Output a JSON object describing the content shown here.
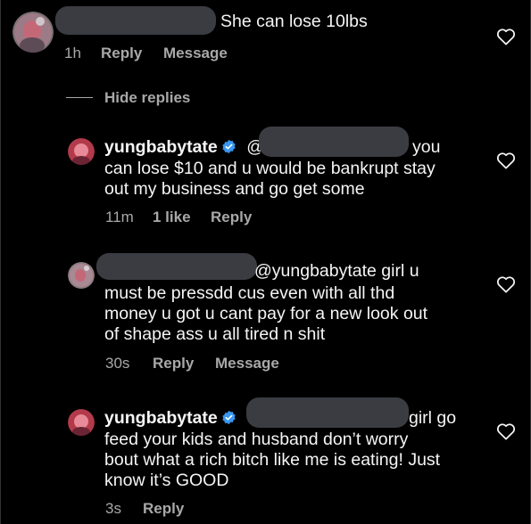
{
  "top_comment": {
    "text": "She can lose 10lbs",
    "time": "1h",
    "reply_label": "Reply",
    "message_label": "Message"
  },
  "thread": {
    "hide_replies_label": "Hide replies"
  },
  "replies": [
    {
      "username": "yungbabytate",
      "mention_start": "@",
      "line1_end": "you",
      "lines": [
        "can lose $10 and u would be bankrupt stay",
        "out my business and go get some"
      ],
      "time": "11m",
      "likes": "1 like",
      "reply_label": "Reply"
    },
    {
      "line1_end": "@yungbabytate girl u",
      "lines": [
        "must be pressdd cus even with all thd",
        "money u got u cant pay for a new look out",
        "of shape ass u all tired n shit"
      ],
      "time": "30s",
      "reply_label": "Reply",
      "message_label": "Message"
    },
    {
      "username": "yungbabytate",
      "line1_end": "girl go",
      "lines": [
        "feed your kids and husband don’t worry",
        "bout what a rich bitch like me is eating! Just",
        "know it’s GOOD"
      ],
      "time": "3s",
      "reply_label": "Reply"
    }
  ],
  "icons": {
    "like": "heart-outline-icon",
    "verified": "verified-badge-icon"
  },
  "colors": {
    "background": "#000000",
    "text": "#f5f5f5",
    "secondary": "#a8a8a8",
    "verified": "#3897f0",
    "redaction": "#3a3c42"
  }
}
